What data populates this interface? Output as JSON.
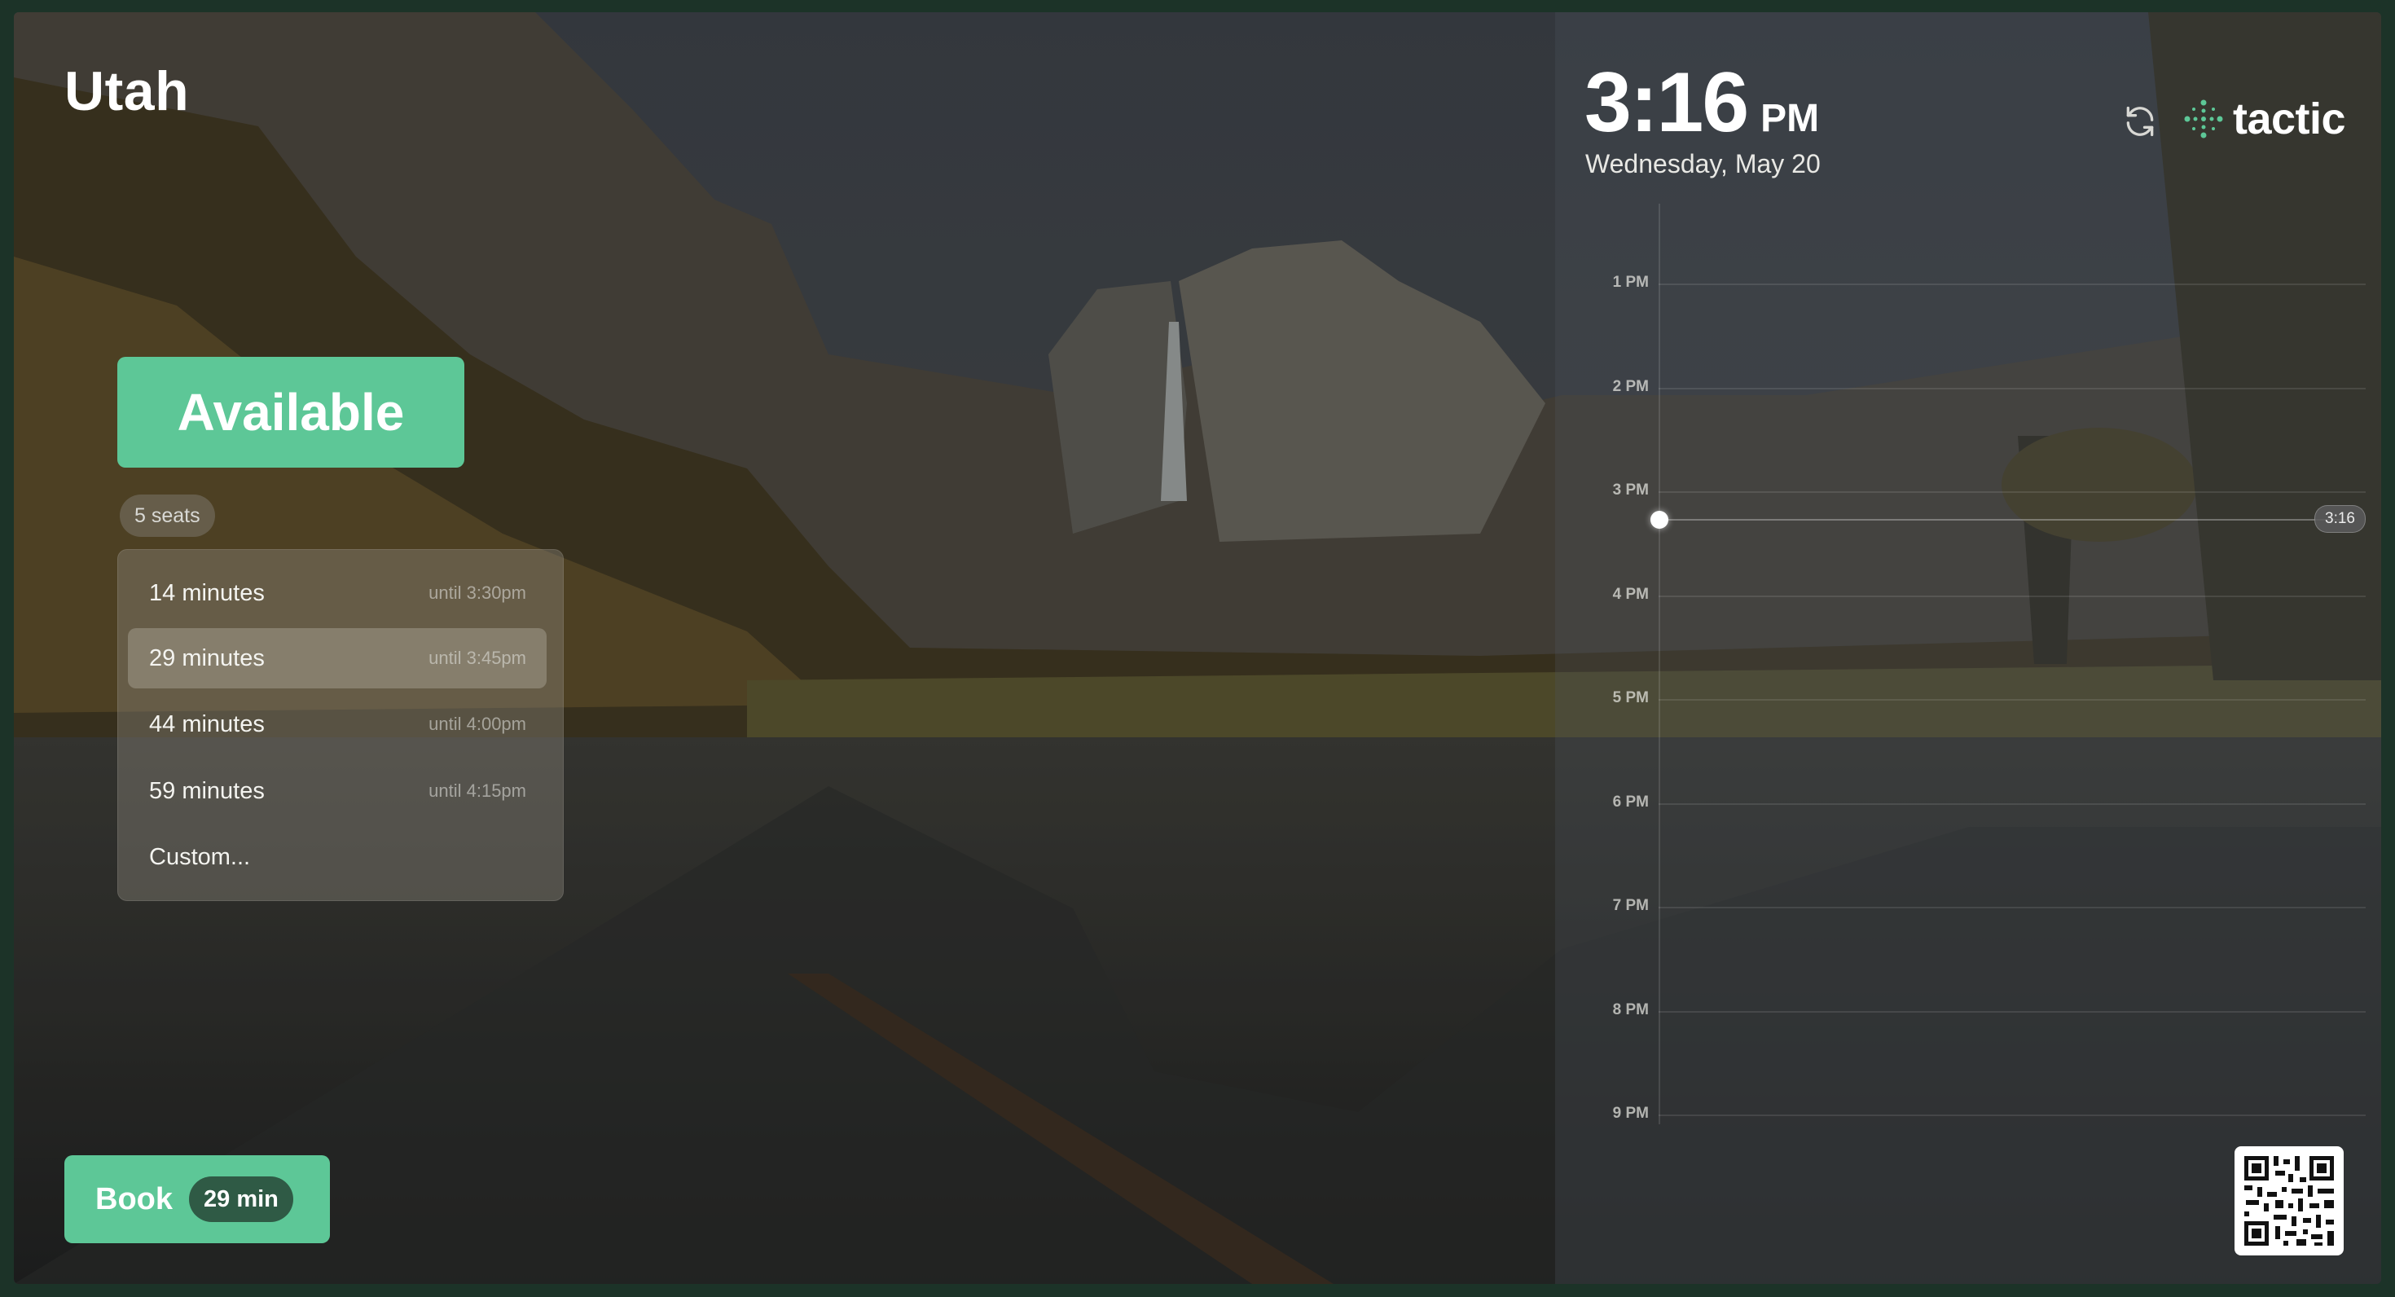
{
  "room": {
    "name": "Utah"
  },
  "status": {
    "label": "Available",
    "color": "#5dc797"
  },
  "seats": {
    "label": "5 seats"
  },
  "durations": [
    {
      "label": "14 minutes",
      "until": "until 3:30pm",
      "selected": false
    },
    {
      "label": "29 minutes",
      "until": "until 3:45pm",
      "selected": true
    },
    {
      "label": "44 minutes",
      "until": "until 4:00pm",
      "selected": false
    },
    {
      "label": "59 minutes",
      "until": "until 4:15pm",
      "selected": false
    },
    {
      "label": "Custom...",
      "until": "",
      "selected": false
    }
  ],
  "book": {
    "label": "Book",
    "duration": "29 min"
  },
  "clock": {
    "time": "3:16",
    "ampm": "PM",
    "date": "Wednesday, May 20"
  },
  "brand": {
    "name": "tactic",
    "accent": "#5dc797"
  },
  "icons": {
    "refresh": "refresh-icon",
    "logo": "tactic-logo-icon",
    "qr": "qr-code-icon"
  },
  "timeline": {
    "hours": [
      "1 PM",
      "2 PM",
      "3 PM",
      "4 PM",
      "5 PM",
      "6 PM",
      "7 PM",
      "8 PM",
      "9 PM"
    ],
    "now_label": "3:16"
  }
}
